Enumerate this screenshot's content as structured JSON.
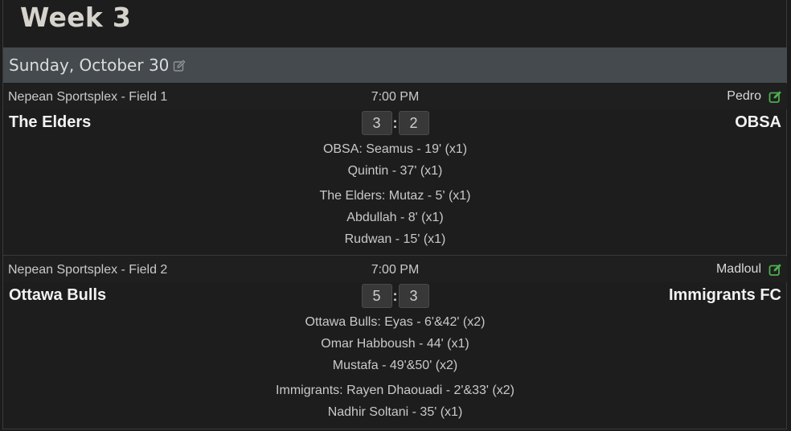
{
  "week": {
    "title": "Week 3"
  },
  "date": {
    "label": "Sunday, October 30",
    "edit_icon": "edit-icon"
  },
  "colors": {
    "accent_green": "#4caf50",
    "date_bar": "#444a4d",
    "background": "#1d1d1d"
  },
  "matches": [
    {
      "venue": "Nepean Sportsplex - Field 1",
      "time": "7:00 PM",
      "referee": "Pedro",
      "home_team": "The Elders",
      "away_team": "OBSA",
      "home_score": "3",
      "score_separator": ":",
      "away_score": "2",
      "away_scorers": [
        "OBSA: Seamus - 19' (x1)",
        "Quintin - 37' (x1)"
      ],
      "home_scorers": [
        "The Elders: Mutaz - 5' (x1)",
        "Abdullah - 8' (x1)",
        "Rudwan - 15' (x1)"
      ]
    },
    {
      "venue": "Nepean Sportsplex - Field 2",
      "time": "7:00 PM",
      "referee": "Madloul",
      "home_team": "Ottawa Bulls",
      "away_team": "Immigrants FC",
      "home_score": "5",
      "score_separator": ":",
      "away_score": "3",
      "home_scorers": [
        "Ottawa Bulls: Eyas - 6'&42' (x2)",
        "Omar Habboush - 44' (x1)",
        "Mustafa - 49'&50' (x2)"
      ],
      "away_scorers": [
        "Immigrants: Rayen Dhaouadi - 2'&33' (x2)",
        "Nadhir Soltani - 35' (x1)"
      ]
    }
  ]
}
